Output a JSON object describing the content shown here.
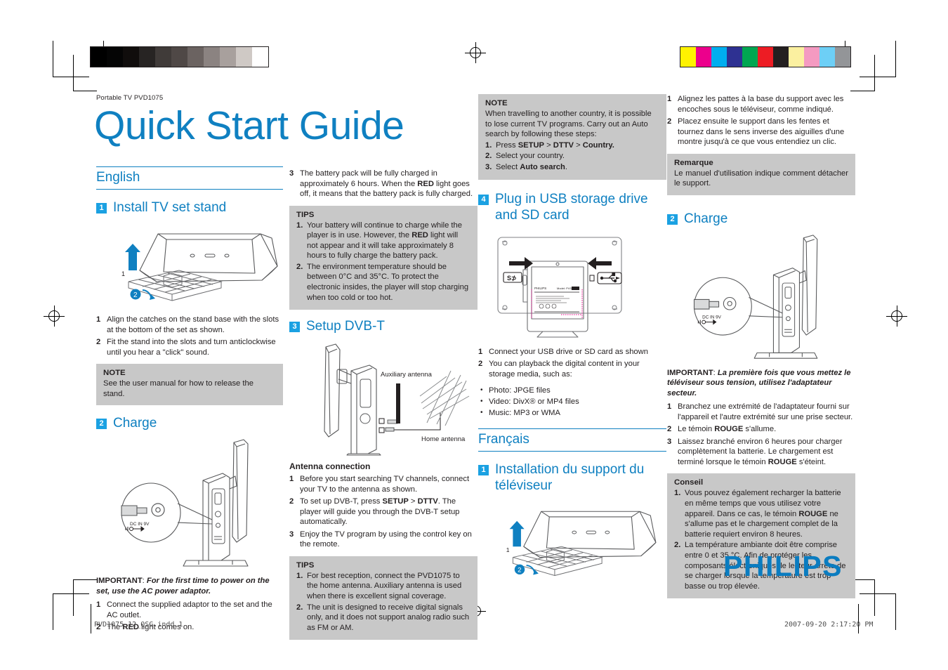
{
  "document": {
    "kicker": "Portable TV PVD1075",
    "title": "Quick Start Guide",
    "brand": "PHILIPS",
    "brand_color": "#0a7cc0",
    "accent_color": "#0f80c1",
    "badge_color": "#1ba1e2",
    "box_color": "#c8c8c8"
  },
  "footer": {
    "file": "PVD1075_12_QSG.indd   1",
    "timestamp": "2007-09-20   2:17:20 PM"
  },
  "print_marks": {
    "gray_swatches": [
      "#000000",
      "#050505",
      "#100d0c",
      "#272423",
      "#403b39",
      "#4f4846",
      "#6b6361",
      "#8b8381",
      "#a8a09d",
      "#cfc9c5",
      "#ffffff"
    ],
    "color_swatches": [
      "#fff200",
      "#ec008c",
      "#00aeef",
      "#2e3192",
      "#00a651",
      "#ed1c24",
      "#231f20",
      "#fbf0a0",
      "#f49ac1",
      "#6dcff6",
      "#939598"
    ]
  },
  "english": {
    "language": "English",
    "sections": [
      {
        "num": "1",
        "title": "Install TV set stand",
        "figure": "tv-stand-assembly-diagram",
        "steps": [
          {
            "n": "1",
            "text": "Align the catches on the stand base with the slots at the bottom of the set as shown."
          },
          {
            "n": "2",
            "text": "Fit the stand into the slots and turn anticlockwise until you hear a \"click\" sound."
          }
        ],
        "note": {
          "title": "NOTE",
          "body": "See the user manual for how to release the stand."
        }
      },
      {
        "num": "2",
        "title": "Charge",
        "figure": "tv-side-dc-in-diagram",
        "important_label": "IMPORTANT",
        "important_text": "For the first time to power on the set, use the AC power adaptor.",
        "steps": [
          {
            "n": "1",
            "text": "Connect the supplied adaptor to the set and the AC outlet."
          },
          {
            "n": "2",
            "text": "The RED light comes on.",
            "bold_words": [
              "RED"
            ]
          },
          {
            "n": "3",
            "text": "The battery pack will be fully charged in approximately 6 hours. When the RED light goes off, it means that the battery pack is fully charged.",
            "bold_words": [
              "RED"
            ]
          }
        ],
        "tips": {
          "title": "TIPS",
          "items": [
            {
              "n": "1.",
              "text": "Your battery will continue to charge while the player is in use. However, the RED light will not appear and it will take approximately 8 hours to fully charge the battery pack."
            },
            {
              "n": "2.",
              "text": "The environment temperature should be between 0°C and 35°C. To protect the electronic insides, the player will stop charging when too cold or too hot."
            }
          ]
        }
      },
      {
        "num": "3",
        "title": "Setup DVB-T",
        "figure": "antenna-connection-diagram",
        "figure_labels": {
          "auxiliary": "Auxiliary antenna",
          "home": "Home antenna"
        },
        "subhead": "Antenna connection",
        "steps": [
          {
            "n": "1",
            "text": "Before you start searching TV channels, connect your TV to the antenna as shown."
          },
          {
            "n": "2",
            "text": "To set up DVB-T, press SETUP > DTTV. The player will guide you through the DVB-T setup automatically."
          },
          {
            "n": "3",
            "text": "Enjoy the TV program by using the control key on the remote."
          }
        ],
        "tips": {
          "title": "TIPS",
          "items": [
            {
              "n": "1.",
              "text": "For best reception, connect the PVD1075 to the home antenna. Auxiliary antenna is used when there is excellent signal coverage."
            },
            {
              "n": "2.",
              "text": "The unit is designed to receive digital signals only, and it does not support analog radio such as FM or AM."
            }
          ]
        },
        "note": {
          "title": "NOTE",
          "body": "When travelling to another country, it is possible to lose current TV programs. Carry out an Auto search by following these steps:",
          "items": [
            {
              "n": "1.",
              "text": "Press SETUP > DTTV > Country."
            },
            {
              "n": "2.",
              "text": "Select your country."
            },
            {
              "n": "3.",
              "text": "Select Auto search."
            }
          ]
        }
      },
      {
        "num": "4",
        "title": "Plug in USB storage drive and SD card",
        "figure": "usb-sd-insert-diagram",
        "steps": [
          {
            "n": "1",
            "text": "Connect your USB drive or SD card as shown"
          },
          {
            "n": "2",
            "text": "You can playback the digital content in your storage media, such as:"
          }
        ],
        "bullets": [
          "Photo: JPGE files",
          "Video: DivX® or MP4 files",
          "Music: MP3 or WMA"
        ]
      }
    ]
  },
  "francais": {
    "language": "Français",
    "sections": [
      {
        "num": "1",
        "title": "Installation du support du téléviseur",
        "figure": "tv-stand-assembly-diagram-fr",
        "steps": [
          {
            "n": "1",
            "text": "Alignez les pattes à la base du support avec les encoches sous le téléviseur, comme indiqué."
          },
          {
            "n": "2",
            "text": "Placez ensuite le support dans les fentes et tournez dans le sens inverse des aiguilles d'une montre jusqu'à ce que vous entendiez un clic."
          }
        ],
        "note": {
          "title": "Remarque",
          "body": "Le manuel d'utilisation indique comment détacher le support."
        }
      },
      {
        "num": "2",
        "title": "Charge",
        "figure": "tv-side-dc-in-diagram-fr",
        "important_label": "IMPORTANT",
        "important_text": "La première fois que vous mettez le téléviseur sous tension, utilisez l'adaptateur secteur.",
        "steps": [
          {
            "n": "1",
            "text": "Branchez une extrémité de l'adaptateur fourni sur l'appareil et l'autre extrémité sur une prise secteur."
          },
          {
            "n": "2",
            "text": "Le témoin ROUGE s'allume."
          },
          {
            "n": "3",
            "text": "Laissez branché environ 6 heures pour charger complètement la batterie. Le chargement est terminé lorsque le témoin ROUGE s'éteint."
          }
        ],
        "tips": {
          "title": "Conseil",
          "items": [
            {
              "n": "1.",
              "text": "Vous pouvez également recharger la batterie en même temps que vous utilisez votre appareil. Dans ce cas, le témoin ROUGE ne s'allume pas et le chargement complet de la batterie requiert environ 8 heures."
            },
            {
              "n": "2.",
              "text": "La température ambiante doit être comprise entre 0 et 35 °C. Afin de protéger les composants électroniques, le lecteur arrête de se charger lorsque la température est trop basse ou trop élevée."
            }
          ]
        }
      }
    ]
  }
}
